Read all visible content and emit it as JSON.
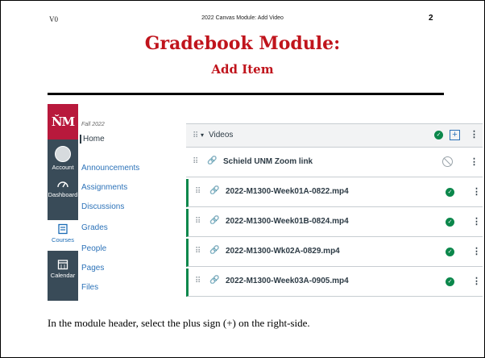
{
  "slide": {
    "version": "V0",
    "header_center": "2022 Canvas Module: Add Video",
    "page_number": "2",
    "title_line1": "Gradebook Module:",
    "title_line2": "Add Item",
    "caption": "In the module header, select the plus sign (+) on the right-side."
  },
  "colors": {
    "title": "#c0141c",
    "logo_bg": "#b8193c",
    "global_nav_bg": "#394b58",
    "link": "#2d73b9",
    "published": "#0b874b"
  },
  "global_nav": {
    "logo": "ŇM",
    "items": [
      {
        "label": "Account",
        "icon": "avatar-icon"
      },
      {
        "label": "Dashboard",
        "icon": "dashboard-icon"
      },
      {
        "label": "Courses",
        "icon": "book-icon",
        "active": true
      },
      {
        "label": "Calendar",
        "icon": "calendar-icon"
      }
    ]
  },
  "course_nav": {
    "term": "Fall 2022",
    "items": [
      "Home",
      "Announcements",
      "Assignments",
      "Discussions",
      "Grades",
      "People",
      "Pages",
      "Files"
    ]
  },
  "module": {
    "header_title": "Videos",
    "items": [
      {
        "title": "Schield UNM Zoom link",
        "published": false
      },
      {
        "title": "2022-M1300-Week01A-0822.mp4",
        "published": true
      },
      {
        "title": "2022-M1300-Week01B-0824.mp4",
        "published": true
      },
      {
        "title": "2022-M1300-Wk02A-0829.mp4",
        "published": true
      },
      {
        "title": "2022-M1300-Week03A-0905.mp4",
        "published": true
      }
    ]
  }
}
